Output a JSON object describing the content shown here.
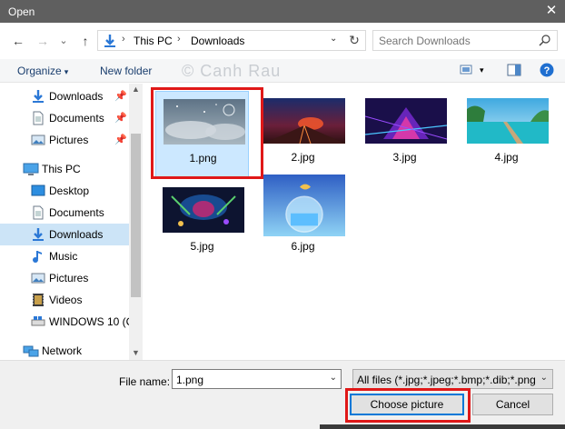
{
  "window": {
    "title": "Open",
    "close_glyph": "✕"
  },
  "nav": {
    "back": "←",
    "forward": "→",
    "recent": "⌄",
    "up": "↑",
    "breadcrumb": [
      "This PC",
      "Downloads"
    ],
    "search_placeholder": "Search Downloads"
  },
  "toolbar": {
    "organize_label": "Organize",
    "new_folder_label": "New folder",
    "watermark": "© Canh Rau"
  },
  "sidebar": {
    "items": [
      {
        "label": "Downloads",
        "icon": "download-arrow-icon",
        "pinned": true
      },
      {
        "label": "Documents",
        "icon": "document-icon",
        "pinned": true
      },
      {
        "label": "Pictures",
        "icon": "pictures-icon",
        "pinned": true
      },
      {
        "label": "This PC",
        "icon": "computer-icon",
        "pinned": false
      },
      {
        "label": "Desktop",
        "icon": "desktop-icon",
        "pinned": false
      },
      {
        "label": "Documents",
        "icon": "document-icon",
        "pinned": false
      },
      {
        "label": "Downloads",
        "icon": "download-arrow-icon",
        "pinned": false,
        "selected": true
      },
      {
        "label": "Music",
        "icon": "music-icon",
        "pinned": false
      },
      {
        "label": "Pictures",
        "icon": "pictures-icon",
        "pinned": false
      },
      {
        "label": "Videos",
        "icon": "videos-icon",
        "pinned": false
      },
      {
        "label": "WINDOWS 10 (C",
        "icon": "drive-icon",
        "pinned": false
      },
      {
        "label": "Network",
        "icon": "network-icon",
        "pinned": false
      }
    ]
  },
  "files": [
    {
      "name": "1.png",
      "selected": true
    },
    {
      "name": "2.jpg"
    },
    {
      "name": "3.jpg"
    },
    {
      "name": "4.jpg"
    },
    {
      "name": "5.jpg"
    },
    {
      "name": "6.jpg"
    }
  ],
  "footer": {
    "filename_label": "File name:",
    "filename_value": "1.png",
    "filter_label": "All files (*.jpg;*.jpeg;*.bmp;*.dib;*.png",
    "choose_label": "Choose picture",
    "cancel_label": "Cancel"
  },
  "colors": {
    "accent": "#0078d7",
    "selection": "#cce8ff",
    "highlight_box": "#e01818",
    "titlebar": "#5f5f5f"
  }
}
